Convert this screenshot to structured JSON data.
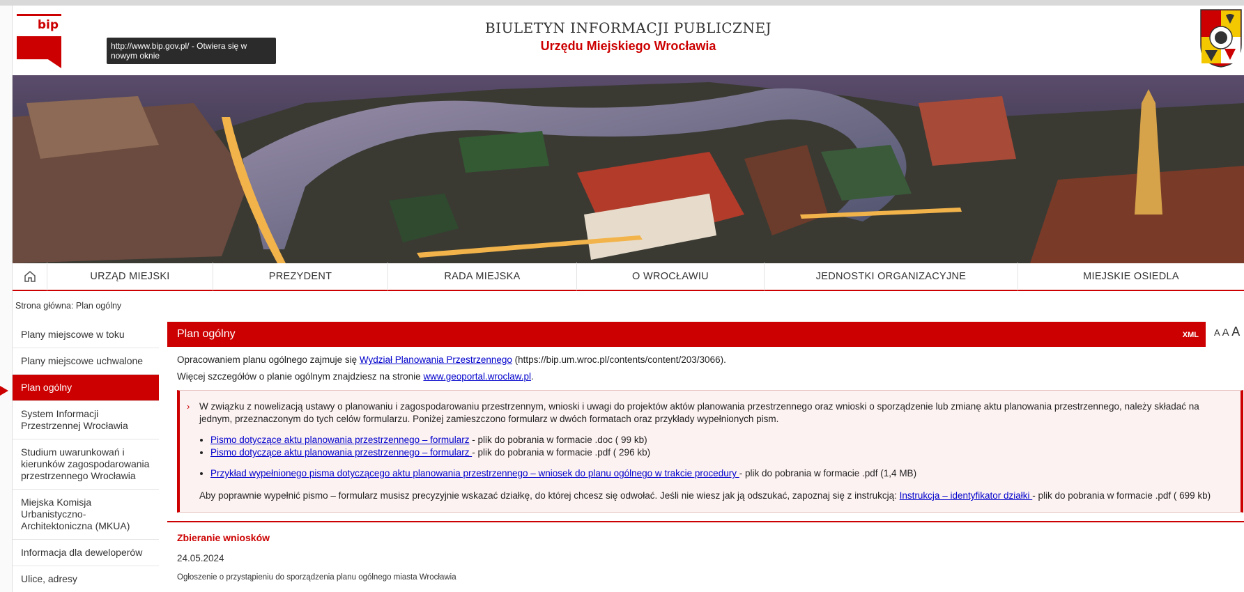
{
  "header": {
    "logo_text": "bip",
    "tooltip": "http://www.bip.gov.pl/ - Otwiera się w nowym oknie",
    "title_line1": "BIULETYN INFORMACJI PUBLICZNEJ",
    "title_line2": "Urzędu Miejskiego Wrocławia"
  },
  "nav": {
    "items": [
      {
        "label": "URZĄD MIEJSKI"
      },
      {
        "label": "PREZYDENT"
      },
      {
        "label": "RADA MIEJSKA"
      },
      {
        "label": "O WROCŁAWIU"
      },
      {
        "label": "JEDNOSTKI ORGANIZACYJNE"
      },
      {
        "label": "MIEJSKIE OSIEDLA"
      }
    ]
  },
  "breadcrumb": "Strona główna: Plan ogólny",
  "sidebar": {
    "items": [
      {
        "label": "Plany miejscowe w toku"
      },
      {
        "label": "Plany miejscowe uchwalone"
      },
      {
        "label": "Plan ogólny"
      },
      {
        "label": "System Informacji Przestrzennej Wrocławia"
      },
      {
        "label": "Studium uwarunkowań i kierunków zagospodarowania przestrzennego Wrocławia"
      },
      {
        "label": "Miejska Komisja Urbanistyczno-Architektoniczna (MKUA)"
      },
      {
        "label": "Informacja dla deweloperów"
      },
      {
        "label": "Ulice, adresy"
      }
    ]
  },
  "font_size": {
    "small": "A",
    "medium": "A",
    "large": "A"
  },
  "main": {
    "title": "Plan ogólny",
    "xml_label": "XML",
    "p1_before": "Opracowaniem planu ogólnego zajmuje się ",
    "p1_link": "Wydział Planowania Przestrzennego",
    "p1_after": " (https://bip.um.wroc.pl/contents/content/203/3066).",
    "p2_before": "Więcej szczegółów o planie ogólnym znajdziesz na stronie ",
    "p2_link": "www.geoportal.wroclaw.pl",
    "p2_after": ".",
    "box": {
      "intro": "W związku z nowelizacją ustawy o planowaniu i zagospodarowaniu przestrzennym, wnioski i uwagi do projektów aktów planowania przestrzennego oraz wnioski o sporządzenie lub zmianę aktu planowania przestrzennego, należy składać na jednym, przeznaczonym do tych celów formularzu. Poniżej zamieszczono formularz w dwóch formatach oraz przykłady wypełnionych pism.",
      "link1": "Pismo dotyczące aktu planowania przestrzennego – formularz",
      "link1_after": " - plik do pobrania w formacie .doc ( 99 kb)",
      "link2": "Pismo dotyczące aktu planowania przestrzennego – formularz ",
      "link2_after": "- plik do pobrania w formacie .pdf ( 296 kb)",
      "link3": "Przykład wypełnionego pisma dotyczącego aktu planowania przestrzennego – wniosek do planu ogólnego w trakcie procedury ",
      "link3_after": " - plik do pobrania w formacie .pdf (1,4 MB)",
      "final_before": "Aby poprawnie wypełnić pismo – formularz musisz precyzyjnie wskazać działkę, do której chcesz się odwołać. Jeśli nie wiesz jak ją odszukać, zapoznaj się z  instrukcją: ",
      "final_link": "Instrukcja – identyfikator działki ",
      "final_after": "- plik do pobrania w formacie .pdf ( 699 kb)"
    },
    "section_title": "Zbieranie wniosków",
    "section_date": "24.05.2024",
    "section_note": "Ogłoszenie o przystąpieniu do sporządzenia planu ogólnego miasta Wrocławia"
  }
}
